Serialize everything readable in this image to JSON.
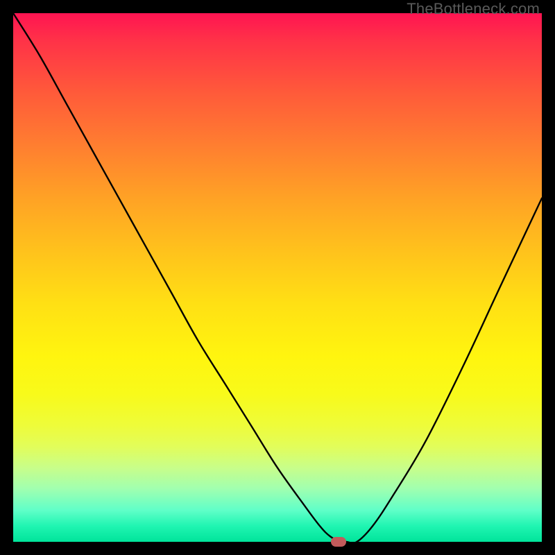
{
  "watermark": "TheBottleneck.com",
  "chart_data": {
    "type": "line",
    "title": "",
    "xlabel": "",
    "ylabel": "",
    "xlim": [
      0,
      100
    ],
    "ylim": [
      0,
      100
    ],
    "series": [
      {
        "name": "bottleneck-curve",
        "x": [
          0,
          5,
          10,
          15,
          20,
          25,
          30,
          35,
          40,
          45,
          50,
          55,
          58,
          60,
          62,
          63,
          65,
          68,
          72,
          78,
          85,
          92,
          100
        ],
        "values": [
          100,
          92,
          83,
          74,
          65,
          56,
          47,
          38,
          30,
          22,
          14,
          7,
          3,
          1,
          0,
          0,
          0,
          3,
          9,
          19,
          33,
          48,
          65
        ]
      }
    ],
    "annotations": [
      {
        "name": "optimal-marker",
        "x": 61.5,
        "y": 0,
        "color": "#c25b5b"
      }
    ],
    "background_gradient": {
      "top": "#ff1452",
      "bottom": "#00e49a",
      "meaning": "red=high bottleneck, green=low bottleneck"
    }
  }
}
